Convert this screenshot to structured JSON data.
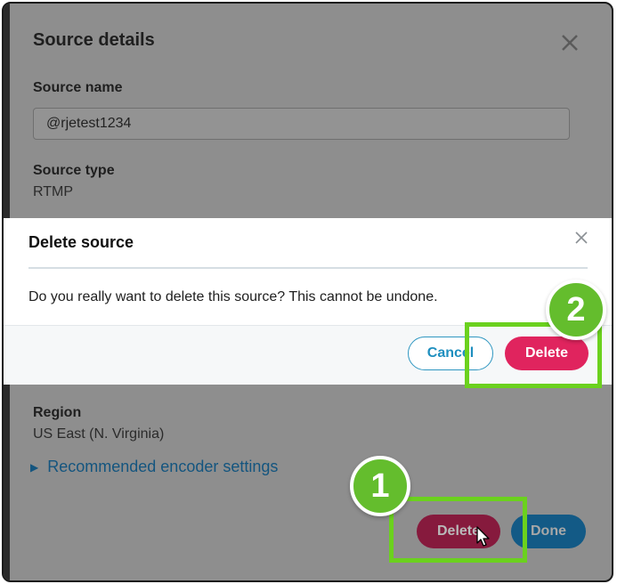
{
  "panel": {
    "title": "Source details",
    "source_name_label": "Source name",
    "source_name_value": "@rjetest1234",
    "source_type_label": "Source type",
    "source_type_value": "RTMP",
    "region_label": "Region",
    "region_value": "US East (N. Virginia)",
    "encoder_link": "Recommended encoder settings",
    "delete_label": "Delete",
    "done_label": "Done"
  },
  "modal": {
    "title": "Delete source",
    "message": "Do you really want to delete this source? This cannot be undone.",
    "cancel_label": "Cancel",
    "delete_label": "Delete"
  },
  "callouts": {
    "step1": "1",
    "step2": "2"
  },
  "colors": {
    "highlight": "#6bd11e",
    "delete_accent": "#e0245e",
    "link": "#1f8fbf"
  }
}
